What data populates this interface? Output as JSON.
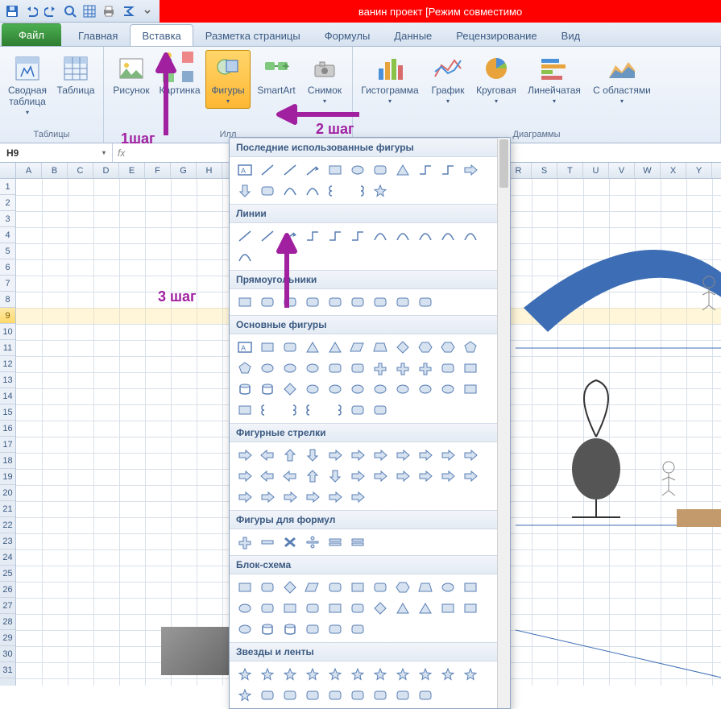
{
  "title": "ванин проект  [Режим совместимо",
  "tabs": {
    "file": "Файл",
    "items": [
      "Главная",
      "Вставка",
      "Разметка страницы",
      "Формулы",
      "Данные",
      "Рецензирование",
      "Вид"
    ],
    "active_index": 1
  },
  "ribbon": {
    "group_tables": {
      "label": "Таблицы",
      "pivot": "Сводная таблица",
      "table": "Таблица"
    },
    "group_illus": {
      "label": "Илл",
      "picture": "Рисунок",
      "clipart": "Картинка",
      "shapes": "Фигуры",
      "smartart": "SmartArt",
      "screenshot": "Снимок"
    },
    "group_charts": {
      "label": "Диаграммы",
      "column": "Гистограмма",
      "line": "График",
      "pie": "Круговая",
      "bar": "Линейчатая",
      "area": "С областями"
    }
  },
  "annotations": {
    "step1": "1шаг",
    "step2": "2 шаг",
    "step3": "3 шаг"
  },
  "namebox": "H9",
  "shapes_panel": {
    "sections": [
      "Последние использованные фигуры",
      "Линии",
      "Прямоугольники",
      "Основные фигуры",
      "Фигурные стрелки",
      "Фигуры для формул",
      "Блок-схема",
      "Звезды и ленты"
    ]
  },
  "columns": [
    "A",
    "B",
    "C",
    "D",
    "E",
    "F",
    "G",
    "H",
    "",
    "",
    "",
    "",
    "",
    "",
    "",
    "",
    "",
    "",
    "",
    "R",
    "S",
    "T",
    "U",
    "V",
    "W",
    "X",
    "Y"
  ],
  "rows": [
    "1",
    "2",
    "3",
    "4",
    "5",
    "6",
    "7",
    "8",
    "9",
    "10",
    "11",
    "12",
    "13",
    "14",
    "15",
    "16",
    "17",
    "18",
    "19",
    "20",
    "21",
    "22",
    "23",
    "24",
    "25",
    "26",
    "27",
    "28",
    "29",
    "30",
    "31"
  ],
  "highlight_row": 9
}
